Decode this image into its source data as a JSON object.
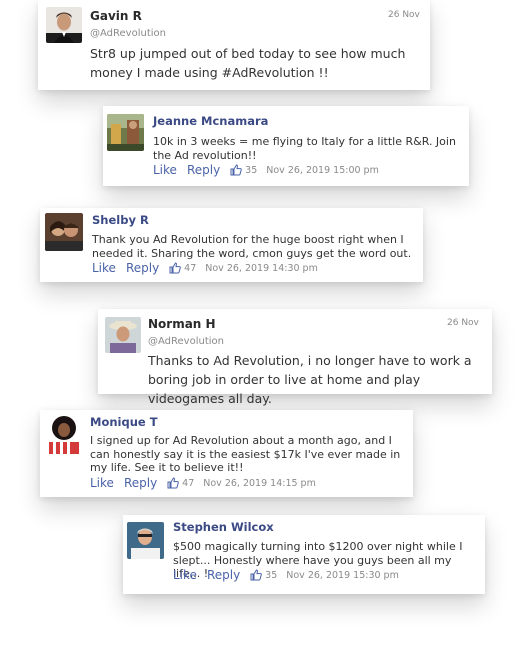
{
  "comments": [
    {
      "name": "Gavin R",
      "handle": "@AdRevolution",
      "date": "26 Nov",
      "text": "Str8 up jumped out of bed today to see how much money I made using #AdRevolution !!"
    },
    {
      "name": "Jeanne Mcnamara",
      "text": "10k in 3 weeks = me flying to Italy for a little R&R. Join the Ad revolution!!",
      "like": "Like",
      "reply": "Reply",
      "likes": "35",
      "timestamp": "Nov 26, 2019 15:00 pm"
    },
    {
      "name": "Shelby R",
      "text": "Thank you Ad Revolution for the huge boost right when I needed it. Sharing the word, cmon guys get the word out.",
      "like": "Like",
      "reply": "Reply",
      "likes": "47",
      "timestamp": "Nov 26, 2019 14:30 pm"
    },
    {
      "name": "Norman H",
      "handle": "@AdRevolution",
      "date": "26 Nov",
      "text": "Thanks to Ad Revolution, i no longer have to work a boring job in order to live at home and play videogames all day."
    },
    {
      "name": "Monique T",
      "text": "I signed up for Ad Revolution about a month ago, and I can honestly say it is the easiest $17k I've ever made in my life. See it to believe it!!",
      "like": "Like",
      "reply": "Reply",
      "likes": "47",
      "timestamp": "Nov 26, 2019 14:15 pm"
    },
    {
      "name": "Stephen Wilcox",
      "text": "$500 magically turning into $1200 over night while I slept... Honestly where have you guys been all my life... !",
      "like": "Like",
      "reply": "Reply",
      "likes": "35",
      "timestamp": "Nov 26, 2019 15:30 pm"
    }
  ],
  "colors": {
    "link": "#4a63a8",
    "name_blue": "#3b4a85",
    "muted": "#8a8a8a"
  }
}
